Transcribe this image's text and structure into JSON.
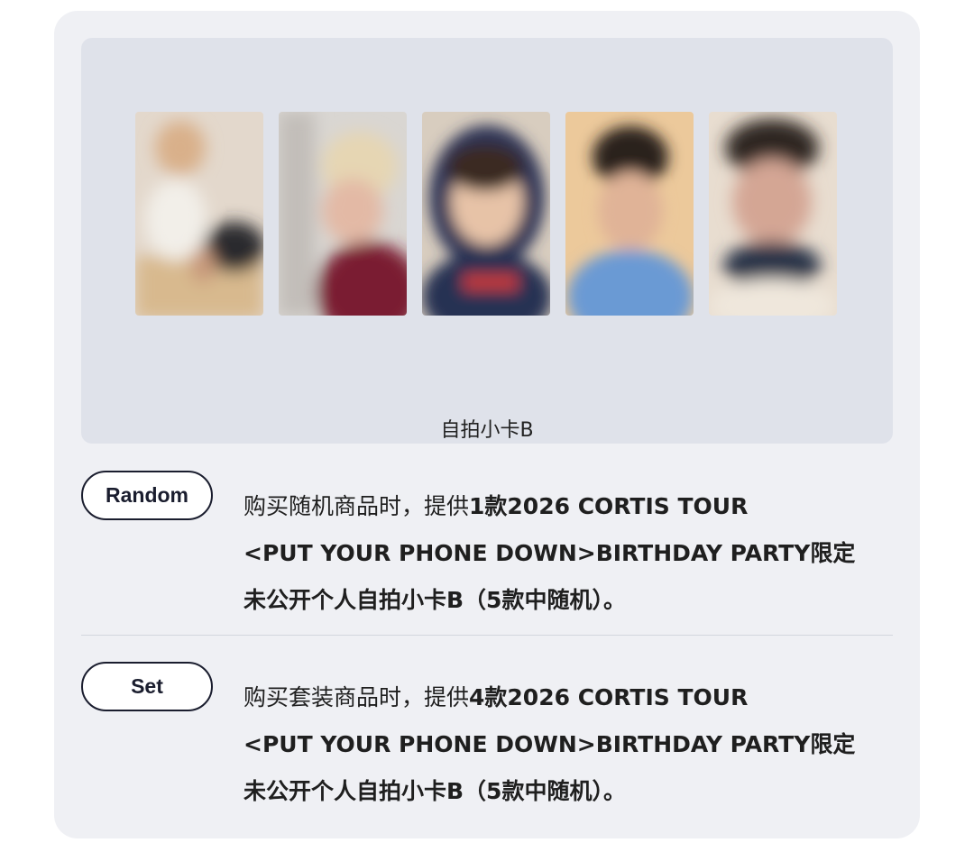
{
  "gallery": {
    "caption": "自拍小卡B",
    "photos": [
      {
        "icon": "photocard-image",
        "bg": "#c9a989"
      },
      {
        "icon": "photocard-image",
        "bg": "#b89a86"
      },
      {
        "icon": "photocard-image",
        "bg": "#6a6f8a"
      },
      {
        "icon": "photocard-image",
        "bg": "#d9b98f"
      },
      {
        "icon": "photocard-image",
        "bg": "#8b7a6f"
      }
    ]
  },
  "options": [
    {
      "pill_label": "Random",
      "lead": "购买随机商品时，提供",
      "line1_bold": "1款2026 CORTIS TOUR",
      "line2": "<PUT YOUR PHONE DOWN>BIRTHDAY PARTY限定",
      "line3": "未公开个人自拍小卡B（5款中随机）。"
    },
    {
      "pill_label": "Set",
      "lead": "购买套装商品时，提供",
      "line1_bold": "4款2026 CORTIS TOUR",
      "line2": "<PUT YOUR PHONE DOWN>BIRTHDAY PARTY限定",
      "line3": "未公开个人自拍小卡B（5款中随机）。"
    }
  ],
  "colors": {
    "card_bg": "#eff0f4",
    "gallery_bg": "#dfe2ea",
    "pill_border": "#1a1d2e",
    "text": "#1f1f1f"
  }
}
